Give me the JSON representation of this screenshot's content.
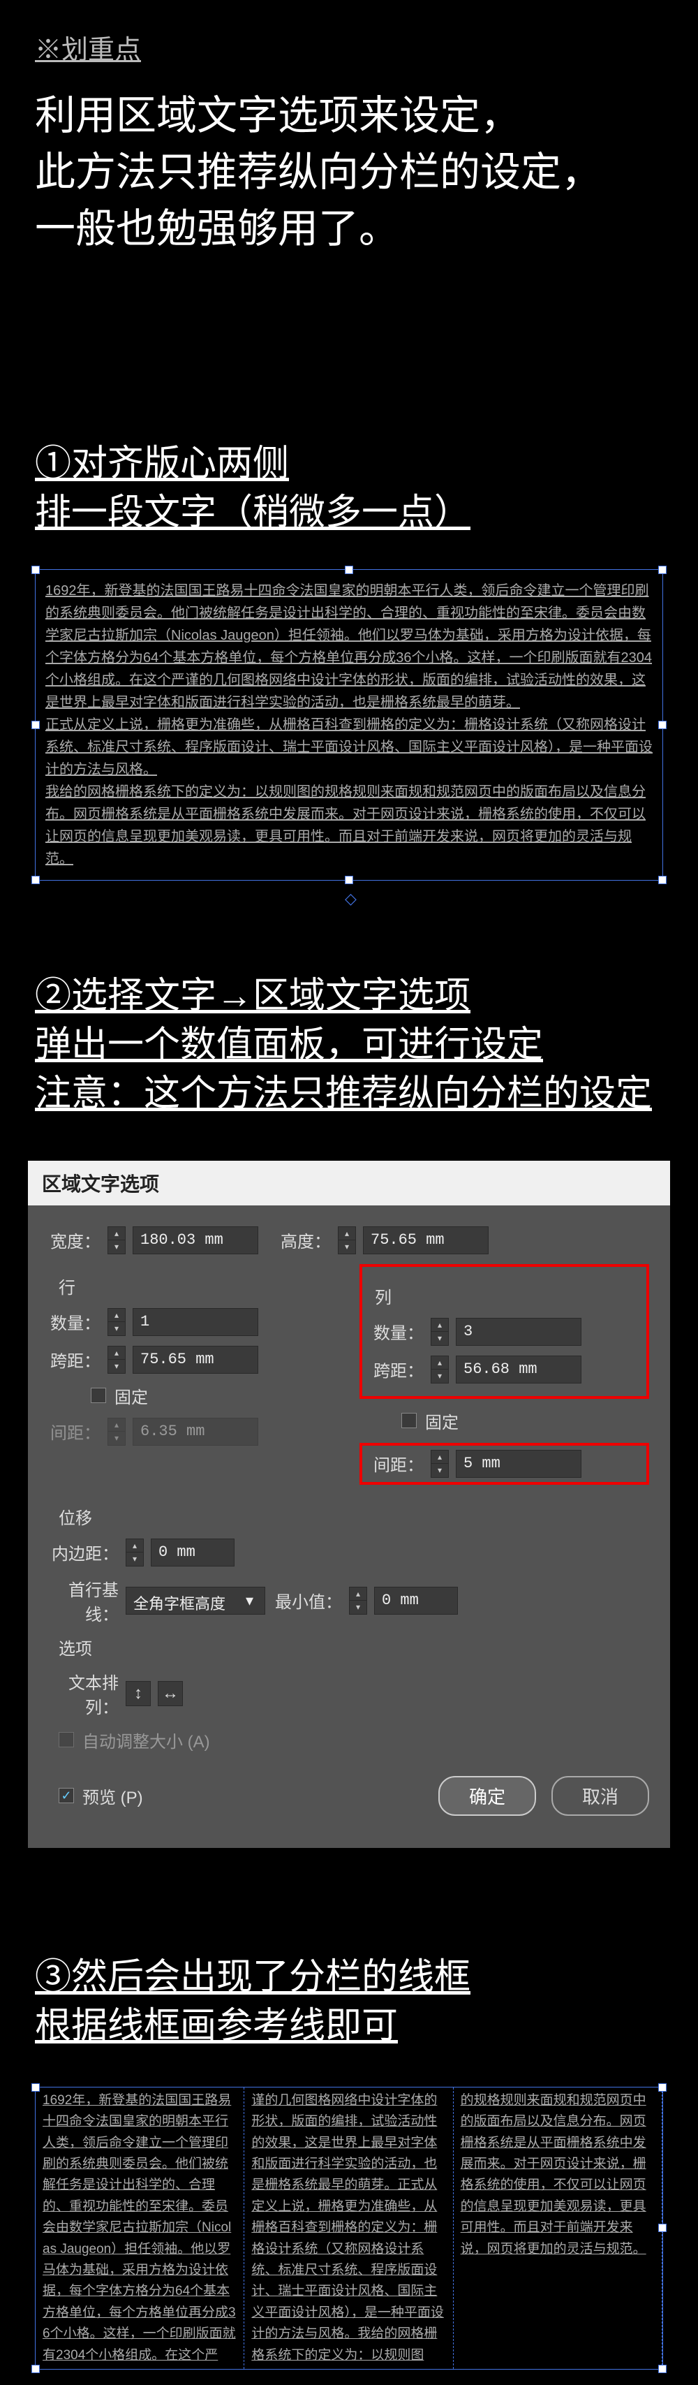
{
  "headingNote": "※划重点",
  "mainTip": "利用区域文字选项来设定，\n此方法只推荐纵向分栏的设定，\n一般也勉强够用了。",
  "step1": {
    "line1": "①对齐版心两侧",
    "line2": "排一段文字（稍微多一点）"
  },
  "sampleBody": "1692年，新登基的法国国王路易十四命令法国皇家的明朝本平行人类，领后命令建立一个管理印刷的系统典则委员会。他门被统解任务是设计出科学的、合理的、重视功能性的至宋律。委员会由数学家尼古拉斯加宗（Nicolas Jaugeon）担任领袖。他们以罗马体为基础，采用方格为设计依据，每个字体方格分为64个基本方格单位，每个方格单位再分成36个小格。这样，一个印刷版面就有2304个小格组成。在这个严谨的几何图格网络中设计字体的形状，版面的编排，试验活动性的效果，这是世界上最早对字体和版面进行科学实验的活动，也是栅格系统最早的萌芽。\n正式从定义上说，栅格更为准确些，从栅格百科查到栅格的定义为：栅格设计系统（又称网格设计系统、标准尺寸系统、程序版面设计、瑞士平面设计风格、国际主义平面设计风格），是一种平面设计的方法与风格。\n我给的网格栅格系统下的定义为：以规则图的规格规则来面规和规范网页中的版面布局以及信息分布。网页栅格系统是从平面栅格系统中发展而来。对于网页设计来说，栅格系统的使用，不仅可以让网页的信息呈现更加美观易读，更具可用性。而且对于前端开发来说，网页将更加的灵活与规范。",
  "step2": {
    "line1": "②选择文字→区域文字选项",
    "line2": "弹出一个数值面板，可进行设定",
    "line3": "注意：这个方法只推荐纵向分栏的设定"
  },
  "dialog": {
    "title": "区域文字选项",
    "widthLabel": "宽度：",
    "widthValue": "180.03 mm",
    "heightLabel": "高度：",
    "heightValue": "75.65 mm",
    "rowSection": "行",
    "colSection": "列",
    "countLabel": "数量：",
    "rowCount": "1",
    "colCount": "3",
    "spanLabel": "跨距：",
    "rowSpan": "75.65 mm",
    "colSpan": "56.68 mm",
    "fixedLabel": "固定",
    "gutterLabel": "间距：",
    "rowGutter": "6.35 mm",
    "colGutter": "5 mm",
    "offsetSection": "位移",
    "insetLabel": "内边距：",
    "insetValue": "0 mm",
    "firstBaselineLabel": "首行基线：",
    "firstBaselineValue": "全角字框高度",
    "minLabel": "最小值：",
    "minValue": "0 mm",
    "optionsSection": "选项",
    "textFlowLabel": "文本排列：",
    "autoSizeLabel": "自动调整大小 (A)",
    "previewLabel": "预览 (P)",
    "ok": "确定",
    "cancel": "取消"
  },
  "step3": {
    "line1": "③然后会出现了分栏的线框",
    "line2": "根据线框画参考线即可"
  },
  "colText1": "1692年，新登基的法国国王路易十四命令法国皇家的明朝本平行人类，领后命令建立一个管理印刷的系统典则委员会。他们被统解任务是设计出科学的、合理的、重视功能性的至宋律。委员会由数学家尼古拉斯加宗（Nicolas Jaugeon）担任领袖。他以罗马体为基础，采用方格为设计依据，每个字体方格分为64个基本方格单位，每个方格单位再分成36个小格。这样，一个印刷版面就有2304个小格组成。在这个严",
  "colText2": "谨的几何图格网络中设计字体的形状，版面的编排，试验活动性的效果，这是世界上最早对字体和版面进行科学实验的活动，也是栅格系统最早的萌芽。正式从定义上说，栅格更为准确些，从栅格百科查到栅格的定义为：栅格设计系统（又称网格设计系统、标准尺寸系统、程序版面设计、瑞士平面设计风格、国际主义平面设计风格），是一种平面设计的方法与风格。我给的网格栅格系统下的定义为：以规则图",
  "colText3": "的规格规则来面规和规范网页中的版面布局以及信息分布。网页栅格系统是从平面栅格系统中发展而来。对于网页设计来说，栅格系统的使用，不仅可以让网页的信息呈现更加美观易读，更具可用性。而且对于前端开发来说，网页将更加的灵活与规范。"
}
